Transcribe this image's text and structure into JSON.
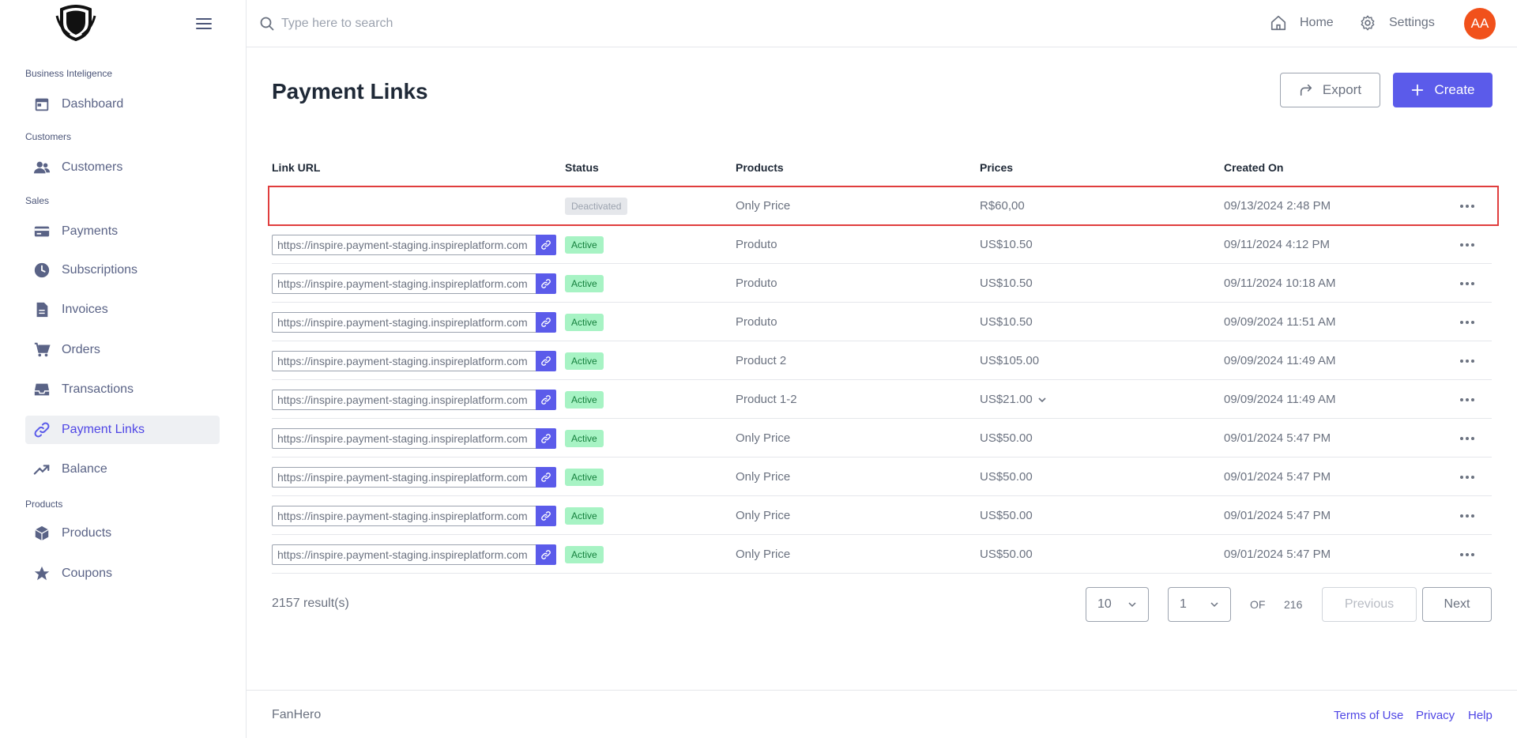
{
  "sidebar": {
    "sections": [
      {
        "label": "Business Inteligence"
      },
      {
        "label": "Customers"
      },
      {
        "label": "Sales"
      },
      {
        "label": "Products"
      }
    ],
    "items": [
      {
        "label": "Dashboard",
        "icon": "calendar-icon"
      },
      {
        "label": "Customers",
        "icon": "users-icon"
      },
      {
        "label": "Payments",
        "icon": "credit-card-icon"
      },
      {
        "label": "Subscriptions",
        "icon": "clock-icon"
      },
      {
        "label": "Invoices",
        "icon": "document-icon"
      },
      {
        "label": "Orders",
        "icon": "cart-icon"
      },
      {
        "label": "Transactions",
        "icon": "inbox-icon"
      },
      {
        "label": "Payment Links",
        "icon": "link-icon",
        "active": true
      },
      {
        "label": "Balance",
        "icon": "trending-up-icon"
      },
      {
        "label": "Products",
        "icon": "cube-icon"
      },
      {
        "label": "Coupons",
        "icon": "star-icon"
      }
    ]
  },
  "topbar": {
    "search_placeholder": "Type here to search",
    "home_label": "Home",
    "settings_label": "Settings",
    "avatar_initials": "AA"
  },
  "main": {
    "title": "Payment Links",
    "export_label": "Export",
    "create_label": "Create",
    "columns": [
      "Link URL",
      "Status",
      "Products",
      "Prices",
      "Created On"
    ],
    "rows": [
      {
        "url": "",
        "status": "Deactivated",
        "product": "Only Price",
        "price": "R$60,00",
        "created": "09/13/2024 2:48 PM"
      },
      {
        "url": "https://inspire.payment-staging.inspireplatform.com",
        "status": "Active",
        "product": "Produto",
        "price": "US$10.50",
        "created": "09/11/2024 4:12 PM"
      },
      {
        "url": "https://inspire.payment-staging.inspireplatform.com",
        "status": "Active",
        "product": "Produto",
        "price": "US$10.50",
        "created": "09/11/2024 10:18 AM"
      },
      {
        "url": "https://inspire.payment-staging.inspireplatform.com",
        "status": "Active",
        "product": "Produto",
        "price": "US$10.50",
        "created": "09/09/2024 11:51 AM"
      },
      {
        "url": "https://inspire.payment-staging.inspireplatform.com",
        "status": "Active",
        "product": "Product 2",
        "price": "US$105.00",
        "created": "09/09/2024 11:49 AM"
      },
      {
        "url": "https://inspire.payment-staging.inspireplatform.com",
        "status": "Active",
        "product": "Product 1-2",
        "price": "US$21.00",
        "created": "09/09/2024 11:49 AM",
        "price_dropdown": true
      },
      {
        "url": "https://inspire.payment-staging.inspireplatform.com",
        "status": "Active",
        "product": "Only Price",
        "price": "US$50.00",
        "created": "09/01/2024 5:47 PM"
      },
      {
        "url": "https://inspire.payment-staging.inspireplatform.com",
        "status": "Active",
        "product": "Only Price",
        "price": "US$50.00",
        "created": "09/01/2024 5:47 PM"
      },
      {
        "url": "https://inspire.payment-staging.inspireplatform.com",
        "status": "Active",
        "product": "Only Price",
        "price": "US$50.00",
        "created": "09/01/2024 5:47 PM"
      },
      {
        "url": "https://inspire.payment-staging.inspireplatform.com",
        "status": "Active",
        "product": "Only Price",
        "price": "US$50.00",
        "created": "09/01/2024 5:47 PM"
      }
    ]
  },
  "pagination": {
    "results_text": "2157 result(s)",
    "page_size": "10",
    "current_page": "1",
    "of_label": "OF",
    "total_pages": "216",
    "previous_label": "Previous",
    "next_label": "Next"
  },
  "footer": {
    "brand": "FanHero",
    "links": [
      "Terms of Use",
      "Privacy",
      "Help"
    ]
  },
  "colors": {
    "accent": "#5b5bea",
    "avatar_bg": "#f1511b",
    "active_badge_bg": "#a7f3c4",
    "highlight_border": "#e03d3d"
  }
}
